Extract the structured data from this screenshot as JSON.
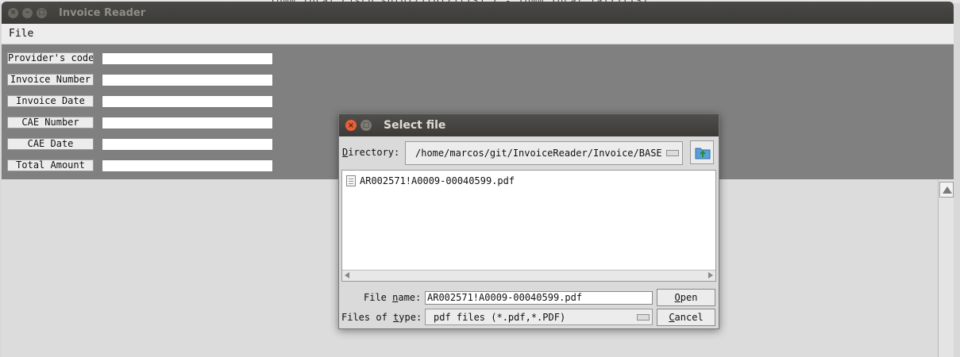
{
  "background_snippet": "Tomm Tocal Cisco.so(UTZ)(UTZ)(IS) I - Tomm Tocal.IaTZ)(IS)",
  "main_window": {
    "title": "Invoice Reader",
    "menu": [
      "File"
    ],
    "form_fields": [
      {
        "label": "Provider's code",
        "value": ""
      },
      {
        "label": "Invoice Number",
        "value": ""
      },
      {
        "label": "Invoice Date",
        "value": ""
      },
      {
        "label": "CAE Number",
        "value": ""
      },
      {
        "label": "CAE Date",
        "value": ""
      },
      {
        "label": "Total Amount",
        "value": ""
      }
    ]
  },
  "dialog": {
    "title": "Select file",
    "directory_label": "Directory:",
    "directory_mnemonic": "D",
    "directory_path": "/home/marcos/git/InvoiceReader/Invoice/BASE",
    "up_folder_icon": "up-folder-icon",
    "files": [
      "AR002571!A0009-00040599.pdf"
    ],
    "file_name_label_pre": "File ",
    "file_name_mnemonic": "n",
    "file_name_label_post": "ame:",
    "file_name_value": "AR002571!A0009-00040599.pdf",
    "files_of_type_label_pre": "Files of ",
    "files_of_type_mnemonic": "t",
    "files_of_type_label_post": "ype:",
    "files_of_type_value": "pdf files (*.pdf,*.PDF)",
    "open_mnemonic": "O",
    "open_rest": "pen",
    "cancel_mnemonic": "C",
    "cancel_rest": "ancel"
  },
  "colors": {
    "titlebar": "#3c3b37",
    "form_background": "#808080",
    "close_button": "#e8603a"
  }
}
